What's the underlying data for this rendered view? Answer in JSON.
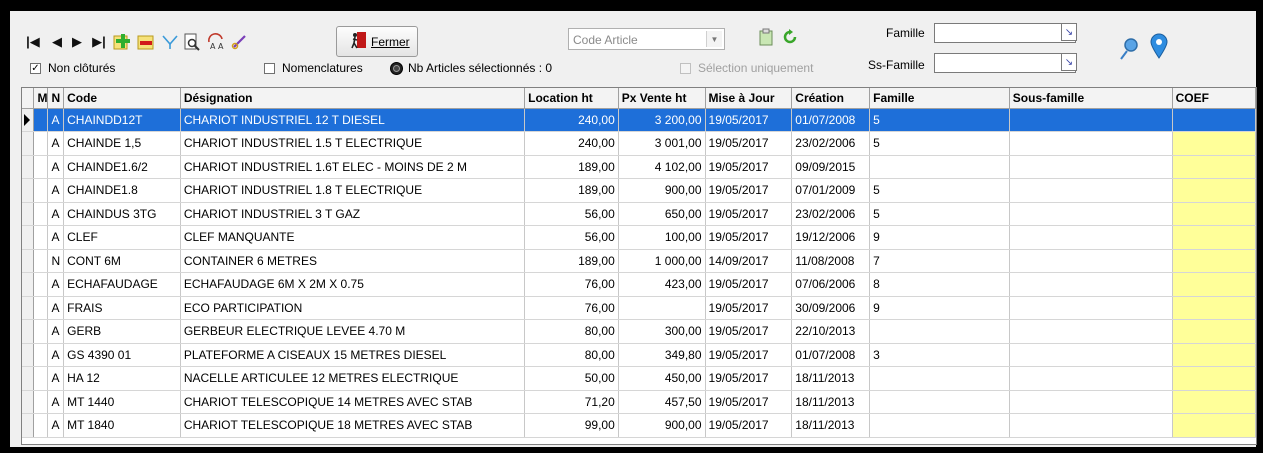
{
  "toolbar": {
    "fermer_label": "Fermer",
    "code_article_placeholder": "Code Article",
    "famille_label": "Famille",
    "ss_famille_label": "Ss-Famille",
    "non_clotures_label": "Non clôturés",
    "non_clotures_checked": true,
    "nomenclatures_label": "Nomenclatures",
    "nomenclatures_checked": false,
    "nb_articles_label": "Nb Articles sélectionnés : 0",
    "selection_uniquement_label": "Sélection uniquement",
    "icons": [
      "first-record-icon",
      "prev-record-icon",
      "next-record-icon",
      "last-record-icon",
      "add-record-icon",
      "delete-record-icon",
      "filter-icon",
      "preview-icon",
      "search-replace-icon",
      "link-icon",
      "exit-icon",
      "clipboard-icon",
      "refresh-icon",
      "pin-icon",
      "map-marker-icon"
    ]
  },
  "grid": {
    "columns": [
      "M",
      "N",
      "Code",
      "Désignation",
      "Location ht",
      "Px Vente ht",
      "Mise à Jour",
      "Création",
      "Famille",
      "Sous-famille",
      "COEF"
    ],
    "selected_row": 0,
    "rows": [
      {
        "m": "",
        "n": "A",
        "code": "CHAINDD12T",
        "designation": "CHARIOT INDUSTRIEL 12 T DIESEL",
        "location": "240,00",
        "px_vente": "3 200,00",
        "maj": "19/05/2017",
        "creation": "01/07/2008",
        "famille": "5",
        "sous_famille": "",
        "coef": ""
      },
      {
        "m": "",
        "n": "A",
        "code": "CHAINDE 1,5",
        "designation": "CHARIOT INDUSTRIEL 1.5 T ELECTRIQUE",
        "location": "240,00",
        "px_vente": "3 001,00",
        "maj": "19/05/2017",
        "creation": "23/02/2006",
        "famille": "5",
        "sous_famille": "",
        "coef": ""
      },
      {
        "m": "",
        "n": "A",
        "code": "CHAINDE1.6/2",
        "designation": "CHARIOT INDUSTRIEL 1.6T ELEC - MOINS DE 2 M",
        "location": "189,00",
        "px_vente": "4 102,00",
        "maj": "19/05/2017",
        "creation": "09/09/2015",
        "famille": "",
        "sous_famille": "",
        "coef": ""
      },
      {
        "m": "",
        "n": "A",
        "code": "CHAINDE1.8",
        "designation": "CHARIOT INDUSTRIEL 1.8 T ELECTRIQUE",
        "location": "189,00",
        "px_vente": "900,00",
        "maj": "19/05/2017",
        "creation": "07/01/2009",
        "famille": "5",
        "sous_famille": "",
        "coef": ""
      },
      {
        "m": "",
        "n": "A",
        "code": "CHAINDUS 3TG",
        "designation": "CHARIOT INDUSTRIEL 3 T GAZ",
        "location": "56,00",
        "px_vente": "650,00",
        "maj": "19/05/2017",
        "creation": "23/02/2006",
        "famille": "5",
        "sous_famille": "",
        "coef": ""
      },
      {
        "m": "",
        "n": "A",
        "code": "CLEF",
        "designation": "CLEF MANQUANTE",
        "location": "56,00",
        "px_vente": "100,00",
        "maj": "19/05/2017",
        "creation": "19/12/2006",
        "famille": "9",
        "sous_famille": "",
        "coef": ""
      },
      {
        "m": "",
        "n": "N",
        "code": "CONT 6M",
        "designation": "CONTAINER 6 METRES",
        "location": "189,00",
        "px_vente": "1 000,00",
        "maj": "14/09/2017",
        "creation": "11/08/2008",
        "famille": "7",
        "sous_famille": "",
        "coef": ""
      },
      {
        "m": "",
        "n": "A",
        "code": "ECHAFAUDAGE",
        "designation": "ECHAFAUDAGE 6M X 2M X 0.75",
        "location": "76,00",
        "px_vente": "423,00",
        "maj": "19/05/2017",
        "creation": "07/06/2006",
        "famille": "8",
        "sous_famille": "",
        "coef": ""
      },
      {
        "m": "",
        "n": "A",
        "code": "FRAIS",
        "designation": "ECO PARTICIPATION",
        "location": "76,00",
        "px_vente": "",
        "maj": "19/05/2017",
        "creation": "30/09/2006",
        "famille": "9",
        "sous_famille": "",
        "coef": ""
      },
      {
        "m": "",
        "n": "A",
        "code": "GERB",
        "designation": "GERBEUR ELECTRIQUE LEVEE 4.70 M",
        "location": "80,00",
        "px_vente": "300,00",
        "maj": "19/05/2017",
        "creation": "22/10/2013",
        "famille": "",
        "sous_famille": "",
        "coef": ""
      },
      {
        "m": "",
        "n": "A",
        "code": "GS 4390 01",
        "designation": "PLATEFORME A CISEAUX 15 METRES DIESEL",
        "location": "80,00",
        "px_vente": "349,80",
        "maj": "19/05/2017",
        "creation": "01/07/2008",
        "famille": "3",
        "sous_famille": "",
        "coef": ""
      },
      {
        "m": "",
        "n": "A",
        "code": "HA 12",
        "designation": "NACELLE ARTICULEE 12 METRES ELECTRIQUE",
        "location": "50,00",
        "px_vente": "450,00",
        "maj": "19/05/2017",
        "creation": "18/11/2013",
        "famille": "",
        "sous_famille": "",
        "coef": ""
      },
      {
        "m": "",
        "n": "A",
        "code": "MT 1440",
        "designation": "CHARIOT TELESCOPIQUE 14 METRES AVEC STAB",
        "location": "71,20",
        "px_vente": "457,50",
        "maj": "19/05/2017",
        "creation": "18/11/2013",
        "famille": "",
        "sous_famille": "",
        "coef": ""
      },
      {
        "m": "",
        "n": "A",
        "code": "MT 1840",
        "designation": "CHARIOT TELESCOPIQUE 18 METRES AVEC STAB",
        "location": "99,00",
        "px_vente": "900,00",
        "maj": "19/05/2017",
        "creation": "18/11/2013",
        "famille": "",
        "sous_famille": "",
        "coef": ""
      }
    ]
  },
  "colors": {
    "selection": "#1e6fd9",
    "coef_bg": "#ffff99",
    "window_bg": "#f0f0f0"
  }
}
